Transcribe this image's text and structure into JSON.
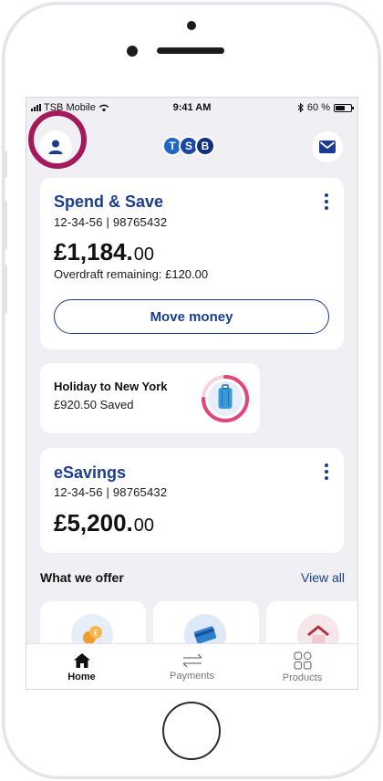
{
  "status_bar": {
    "carrier": "TSB Mobile",
    "time": "9:41 AM",
    "battery": "60 %",
    "battery_level": 0.6
  },
  "header": {
    "logo_letters": [
      "T",
      "S",
      "B"
    ],
    "logo_colors": [
      "#1e66c7",
      "#1848a8",
      "#11307e"
    ]
  },
  "accounts": [
    {
      "name": "Spend & Save",
      "number": "12-34-56 | 98765432",
      "balance_main": "£1,184.",
      "balance_pence": "00",
      "overdraft": "Overdraft remaining: £120.00",
      "action_label": "Move money"
    },
    {
      "name": "eSavings",
      "number": "12-34-56 | 98765432",
      "balance_main": "£5,200.",
      "balance_pence": "00"
    }
  ],
  "goal": {
    "title": "Holiday to New York",
    "saved": "£920.50 Saved",
    "icon": "suitcase-icon"
  },
  "offers": {
    "title": "What we offer",
    "view_all": "View all",
    "icons": [
      "coins-icon",
      "credit-card-icon",
      "house-icon"
    ]
  },
  "nav": [
    {
      "label": "Home",
      "icon": "home-icon"
    },
    {
      "label": "Payments",
      "icon": "transfer-arrows-icon"
    },
    {
      "label": "Products",
      "icon": "grid-icon"
    }
  ],
  "colors": {
    "brand_blue": "#1b3d8f",
    "highlight_ring": "#a3195b",
    "goal_ring": "#e2457c"
  }
}
